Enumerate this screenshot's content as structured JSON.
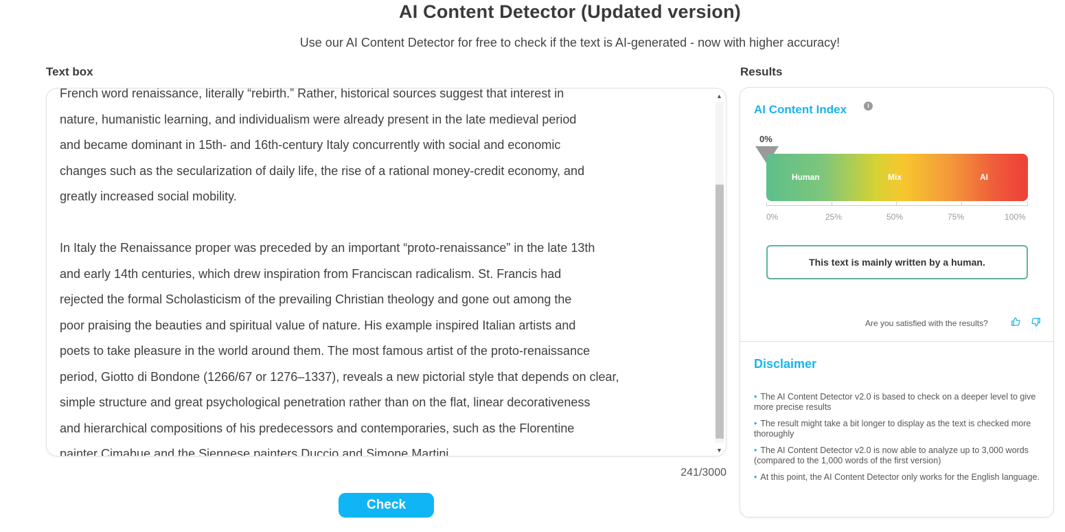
{
  "header": {
    "title": "AI Content Detector (Updated version)",
    "subtitle": "Use our AI Content Detector for free to check if the text is AI-generated - now with higher accuracy!"
  },
  "textbox": {
    "label": "Text box",
    "lines": [
      "French word renaissance, literally “rebirth.” Rather, historical sources suggest that interest in",
      "nature, humanistic learning, and individualism were already present in the late medieval period",
      "and became dominant in 15th- and 16th-century Italy concurrently with social and economic",
      "changes such as the secularization of daily life, the rise of a rational money-credit economy, and",
      "greatly increased social mobility.",
      "",
      "In Italy the Renaissance proper was preceded by an important “proto-renaissance” in the late 13th",
      "and early 14th centuries, which drew inspiration from Franciscan radicalism.  St. Francis had",
      "rejected the formal Scholasticism of the prevailing Christian theology and gone out among the",
      "poor praising the beauties and spiritual value of nature. His example inspired Italian artists and",
      "poets to take pleasure in the world around them. The most famous artist of the proto-renaissance",
      "period, Giotto di Bondone (1266/67 or 1276–1337), reveals a new pictorial style that depends on clear,",
      "simple structure and great psychological penetration rather than on the flat, linear decorativeness",
      "and hierarchical compositions of his predecessors and contemporaries, such as the Florentine",
      "painter Cimabue and the Siennese painters Duccio and Simone Martini."
    ],
    "word_count": "241/3000",
    "check_label": "Check"
  },
  "results": {
    "label": "Results",
    "index_title": "AI Content Index",
    "info_icon": "i",
    "score_label": "0%",
    "score_value": 0,
    "gauge_labels": {
      "human": "Human",
      "mix": "Mix",
      "ai": "AI"
    },
    "scale": [
      "0%",
      "25%",
      "50%",
      "75%",
      "100%"
    ],
    "verdict": "This text is mainly written by a human.",
    "feedback_prompt": "Are you satisfied with the results?",
    "colors": {
      "accent": "#1bb3ec",
      "button": "#10b5f5",
      "verdict_border": "#5cb395",
      "pointer": "#9a9a9a"
    }
  },
  "disclaimer": {
    "title": "Disclaimer",
    "items": [
      "The AI Content Detector v2.0 is based to check on a deeper level to give more precise results",
      "The result might take a bit longer to display as the text is checked more thoroughly",
      "The AI Content Detector v2.0 is now able to analyze up to 3,000 words (compared to the 1,000 words of the first version)",
      "At this point, the AI Content Detector only works for the English language."
    ]
  }
}
